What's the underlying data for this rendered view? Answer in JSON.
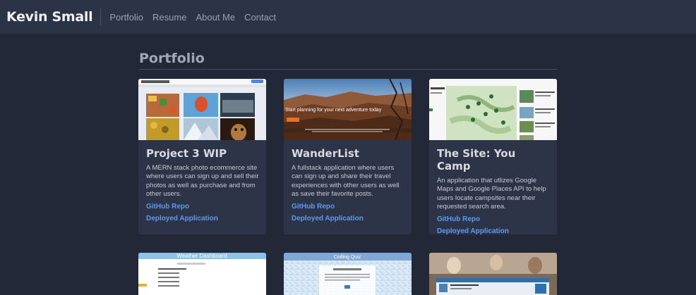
{
  "nav": {
    "brand": "Kevin Small",
    "links": [
      "Portfolio",
      "Resume",
      "About Me",
      "Contact"
    ]
  },
  "section": {
    "title": "Portfolio"
  },
  "projects": [
    {
      "title": "Project 3 WIP",
      "description": "A MERN stack photo ecommerce site where users can sign up and sell their photos as well as purchase and from other users.",
      "repo_label": "GitHub Repo",
      "deploy_label": "Deployed Application"
    },
    {
      "title": "WanderList",
      "description": "A fullstack application where users can sign up and share their travel experiences with other users as well as save their favorite posts.",
      "repo_label": "GitHub Repo",
      "deploy_label": "Deployed Application",
      "thumb_headline": "Start planning for your next adventure today"
    },
    {
      "title": "The Site: You Camp",
      "description": "An application that utlizes Google Maps and Google Places API to help users locate campsites near their requested search area.",
      "repo_label": "GitHub Repo",
      "deploy_label": "Deployed Application"
    }
  ],
  "second_row": [
    {
      "thumb_label": "Weather Dashboard"
    },
    {
      "thumb_label": "Coding Quiz"
    },
    {
      "thumb_label": ""
    }
  ],
  "colors": {
    "background": "#232838",
    "navbar": "#2d3347",
    "card": "#2e3447",
    "link": "#5b9bf0"
  }
}
